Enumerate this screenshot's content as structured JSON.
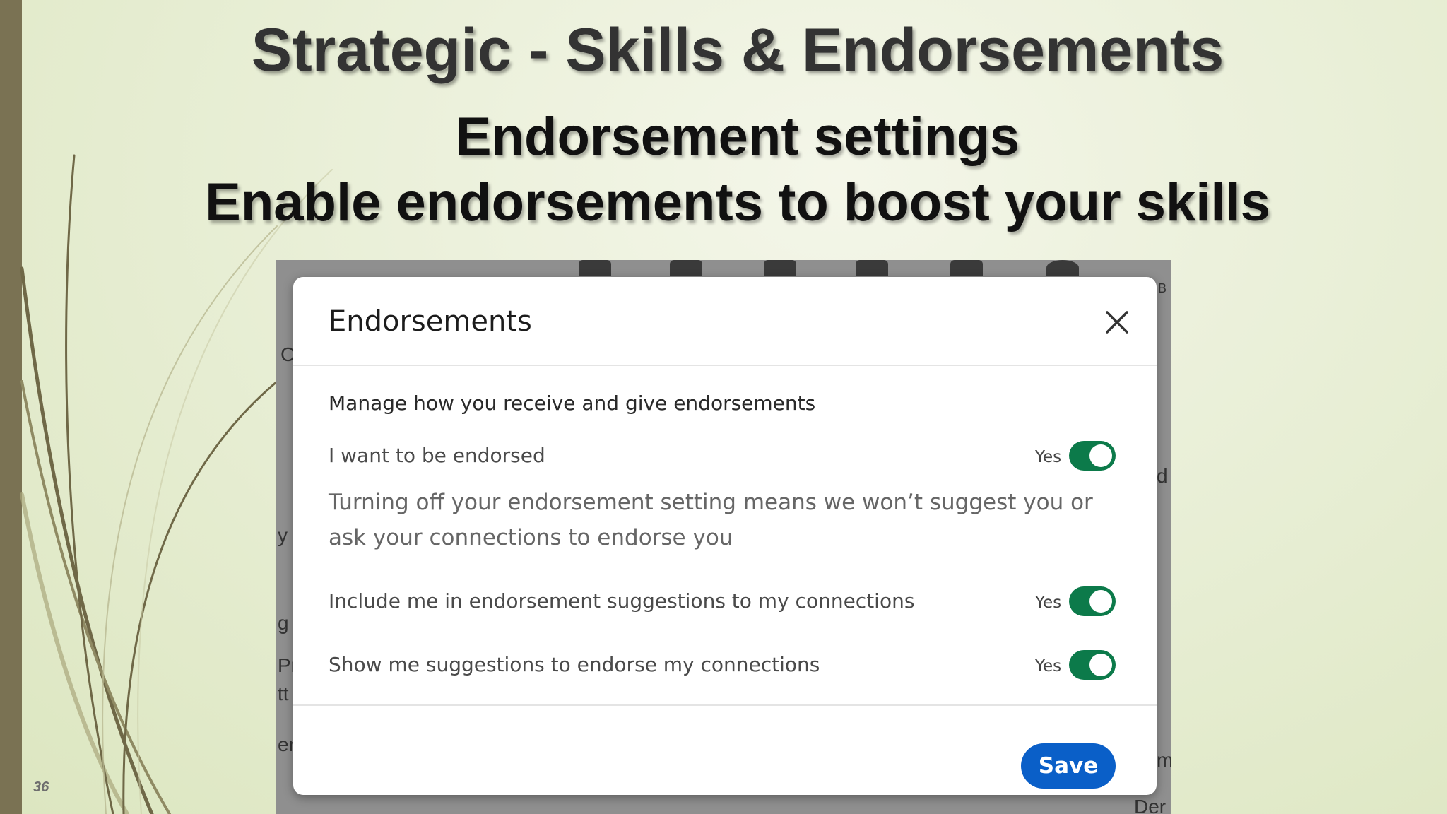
{
  "slide": {
    "title": "Strategic - Skills & Endorsements",
    "subtitle_1": "Endorsement settings",
    "subtitle_2": "Enable endorsements to boost your skills",
    "number": "36"
  },
  "modal": {
    "title": "Endorsements",
    "intro": "Manage how you receive and give endorsements",
    "settings": [
      {
        "label": "I want to be endorsed",
        "value_label": "Yes",
        "enabled": true,
        "description": "Turning off your endorsement setting means we won’t suggest you or ask your connections to endorse you"
      },
      {
        "label": "Include me in endorsement suggestions to my connections",
        "value_label": "Yes",
        "enabled": true
      },
      {
        "label": "Show me suggestions to endorse my connections",
        "value_label": "Yes",
        "enabled": true
      }
    ],
    "save_label": "Save"
  },
  "background_fragments": [
    "C",
    "y",
    "g",
    "Pr",
    "tt",
    "en",
    "m",
    "Der",
    "d",
    "B"
  ],
  "colors": {
    "toggle_on": "#0c7a4a",
    "save_button": "#0a5fc8",
    "left_bar": "#7a7253"
  }
}
